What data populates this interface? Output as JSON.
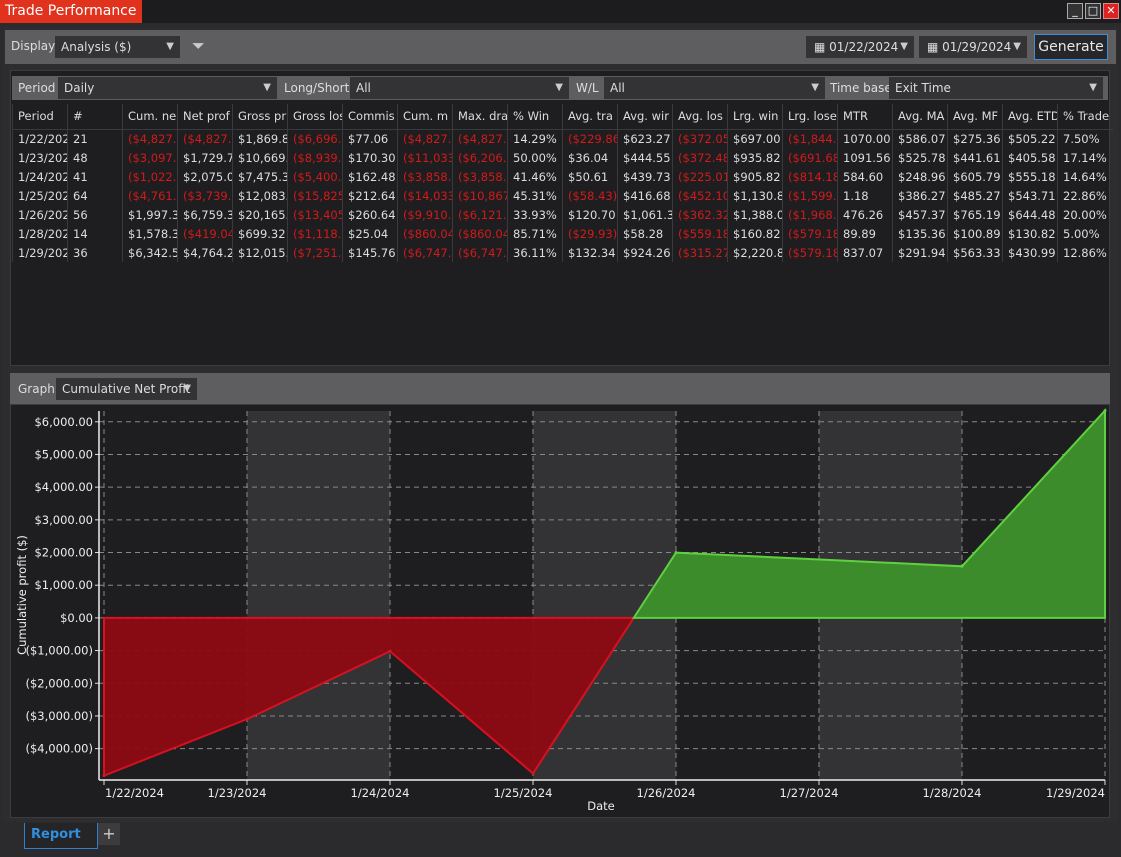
{
  "window": {
    "title": "Trade Performance"
  },
  "toolbar": {
    "display_label": "Display",
    "display_value": "Analysis ($)",
    "start_date": "01/22/2024",
    "end_date": "01/29/2024",
    "generate": "Generate"
  },
  "filters": {
    "period_label": "Period",
    "period_value": "Daily",
    "longshort_label": "Long/Short",
    "longshort_value": "All",
    "wl_label": "W/L",
    "wl_value": "All",
    "timebase_label": "Time base",
    "timebase_value": "Exit Time"
  },
  "table": {
    "headers": [
      "Period",
      "#",
      "Cum. ne",
      "Net prof",
      "Gross pr",
      "Gross los",
      "Commis",
      "Cum. m",
      "Max. dra",
      "% Win",
      "Avg. tra",
      "Avg. wir",
      "Avg. los",
      "Lrg. win",
      "Lrg. lose",
      "MTR",
      "Avg. MA",
      "Avg. MF",
      "Avg. ETD",
      "% Trade"
    ],
    "rows": [
      [
        "1/22/202",
        "21",
        "($4,827.0",
        "($4,827.0",
        "$1,869.8",
        "($6,696.",
        "$77.06",
        "($4,827.0",
        "($4,827.0",
        "14.29%",
        "($229.86",
        "$623.27",
        "($372.05",
        "$697.00",
        "($1,844.",
        "1070.00",
        "$586.07",
        "$275.36",
        "$505.22",
        "7.50%"
      ],
      [
        "1/23/202",
        "48",
        "($3,097.3",
        "$1,729.7",
        "$10,669.",
        "($8,939.",
        "$170.30",
        "($11,033",
        "($6,206.2",
        "50.00%",
        "$36.04",
        "$444.55",
        "($372.48",
        "$935.82",
        "($691.68",
        "1091.56",
        "$525.78",
        "$441.61",
        "$405.58",
        "17.14%"
      ],
      [
        "1/24/202",
        "41",
        "($1,022.3",
        "$2,075.0",
        "$7,475.3",
        "($5,400.",
        "$162.48",
        "($3,858.4",
        "($3,858.4",
        "41.46%",
        "$50.61",
        "$439.73",
        "($225.01",
        "$905.82",
        "($814.18",
        "584.60",
        "$248.96",
        "$605.79",
        "$555.18",
        "14.64%"
      ],
      [
        "1/25/202",
        "64",
        "($4,761.5",
        "($3,739.8",
        "$12,083.",
        "($15,825",
        "$212.64",
        "($14,033",
        "($10,867",
        "45.31%",
        "($58.43)",
        "$416.68",
        "($452.10",
        "$1,130.8",
        "($1,599.7",
        "1.18",
        "$386.27",
        "$485.27",
        "$543.71",
        "22.86%"
      ],
      [
        "1/26/202",
        "56",
        "$1,997.3",
        "$6,759.3",
        "$20,165.",
        "($13,405",
        "$260.64",
        "($9,910.3",
        "($6,121.7",
        "33.93%",
        "$120.70",
        "$1,061.3",
        "($362.32",
        "$1,388.0",
        "($1,968.3",
        "476.26",
        "$457.37",
        "$765.19",
        "$644.48",
        "20.00%"
      ],
      [
        "1/28/202",
        "14",
        "$1,578.3",
        "($419.04",
        "$699.32",
        "($1,118.",
        "$25.04",
        "($860.04",
        "($860.04",
        "85.71%",
        "($29.93)",
        "$58.28",
        "($559.18",
        "$160.82",
        "($579.18",
        "89.89",
        "$135.36",
        "$100.89",
        "$130.82",
        "5.00%"
      ],
      [
        "1/29/202",
        "36",
        "$6,342.5",
        "$4,764.2",
        "$12,015.",
        "($7,251.",
        "$145.76",
        "($6,747.3",
        "($6,747.7",
        "36.11%",
        "$132.34",
        "$924.26",
        "($315.27",
        "$2,220.8",
        "($579.18",
        "837.07",
        "$291.94",
        "$563.33",
        "$430.99",
        "12.86%"
      ]
    ]
  },
  "graph": {
    "label": "Graph",
    "value": "Cumulative Net Profit"
  },
  "chart_data": {
    "type": "area",
    "xlabel": "Date",
    "ylabel": "Cumulative profit ($)",
    "x": [
      "1/22/2024",
      "1/23/2024",
      "1/24/2024",
      "1/25/2024",
      "1/26/2024",
      "1/28/2024",
      "1/29/2024"
    ],
    "x_ticks": [
      "1/22/2024",
      "1/23/2024",
      "1/24/2024",
      "1/25/2024",
      "1/26/2024",
      "1/27/2024",
      "1/28/2024",
      "1/29/2024"
    ],
    "y": [
      -4827.0,
      -3097.3,
      -1022.3,
      -4761.5,
      1997.3,
      1578.3,
      6342.5
    ],
    "y_ticks": [
      "($4,000.00)",
      "($3,000.00)",
      "($2,000.00)",
      "($1,000.00)",
      "$0.00",
      "$1,000.00",
      "$2,000.00",
      "$3,000.00",
      "$4,000.00",
      "$5,000.00",
      "$6,000.00"
    ],
    "ylim": [
      -4960,
      6330
    ],
    "grid": true,
    "colors": {
      "positive": "#3c8c2c",
      "positive_line": "#5fd040",
      "negative": "#8e0a14",
      "negative_line": "#e01020"
    }
  },
  "tabs": {
    "report": "Report",
    "add": "+"
  }
}
